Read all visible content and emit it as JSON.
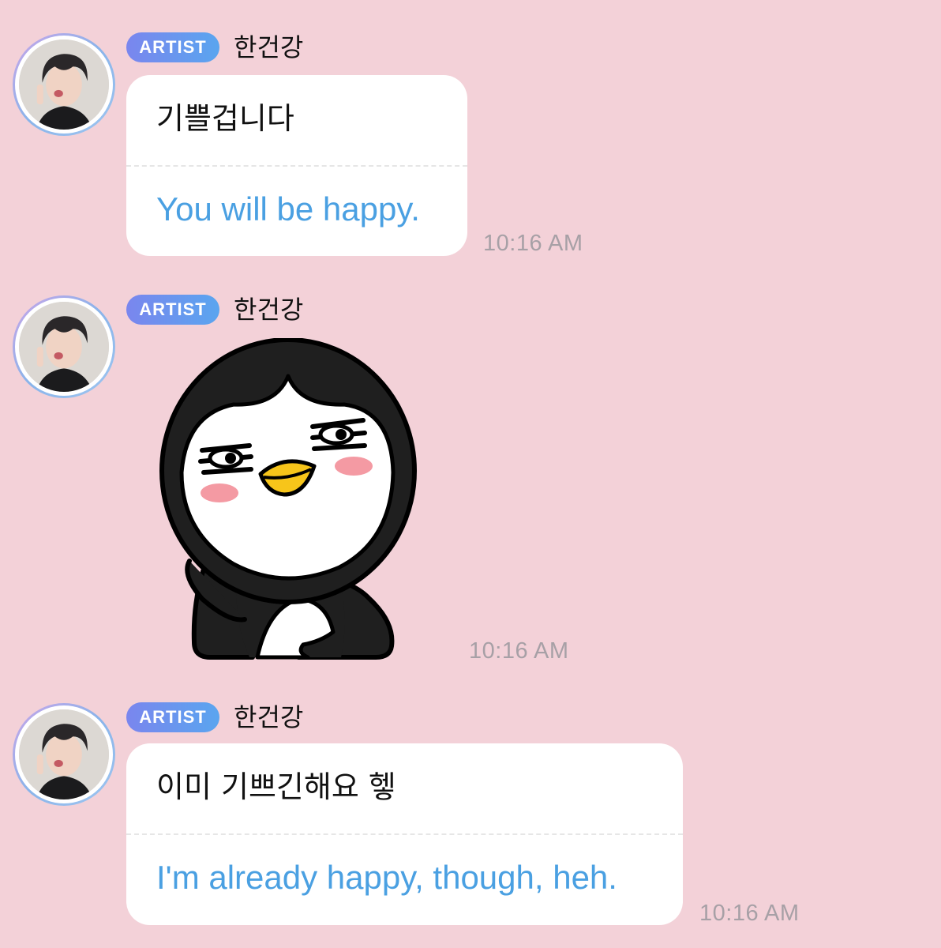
{
  "messages": [
    {
      "badge": "ARTIST",
      "sender": "한건강",
      "original": "기쁠겁니다",
      "translation": "You will be happy.",
      "time": "10:16 AM"
    },
    {
      "badge": "ARTIST",
      "sender": "한건강",
      "sticker": "penguin-sticker",
      "time": "10:16 AM"
    },
    {
      "badge": "ARTIST",
      "sender": "한건강",
      "original": "이미 기쁘긴해요 헿",
      "translation": "I'm already happy, though, heh.",
      "time": "10:16 AM"
    }
  ],
  "colors": {
    "background": "#f3d1d8",
    "bubble": "#ffffff",
    "translation_text": "#4aa0e2",
    "badge_gradient_start": "#7a86ee",
    "badge_gradient_end": "#5aa5ef",
    "timestamp": "#a7a0a6"
  }
}
